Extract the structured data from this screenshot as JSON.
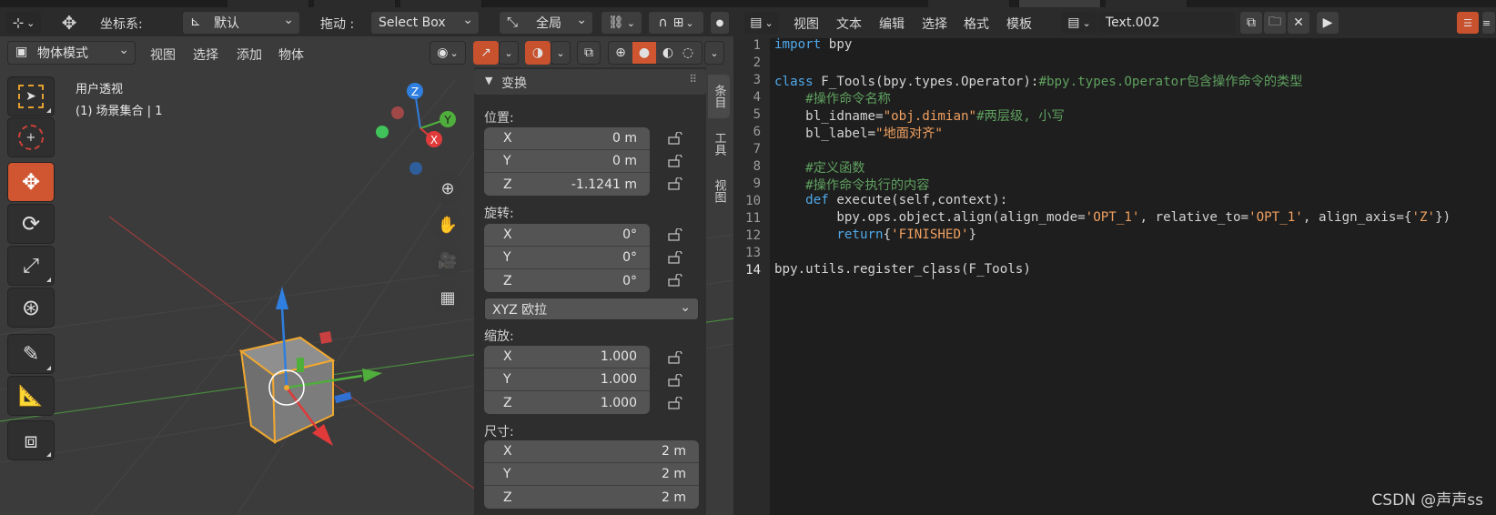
{
  "viewport": {
    "header": {
      "coord_label": "坐标系:",
      "coord_value": "默认",
      "drag_label": "拖动 :",
      "drag_value": "Select Box",
      "pivot_value": "全局"
    },
    "header2": {
      "mode_value": "物体模式",
      "menu": [
        "视图",
        "选择",
        "添加",
        "物体"
      ]
    },
    "overlay_title": "用户透视",
    "overlay_collection": "(1) 场景集合 | 1",
    "gizmo_axes": [
      "Z",
      "Y",
      "X"
    ],
    "tools": [
      "select-box",
      "cursor",
      "move",
      "rotate",
      "scale",
      "transform",
      "annotate",
      "measure",
      "add-cube"
    ],
    "active_tool": "move"
  },
  "npanel": {
    "header": "变换",
    "location_label": "位置:",
    "location": [
      {
        "axis": "X",
        "value": "0 m"
      },
      {
        "axis": "Y",
        "value": "0 m"
      },
      {
        "axis": "Z",
        "value": "-1.1241 m"
      }
    ],
    "rotation_label": "旋转:",
    "rotation": [
      {
        "axis": "X",
        "value": "0°"
      },
      {
        "axis": "Y",
        "value": "0°"
      },
      {
        "axis": "Z",
        "value": "0°"
      }
    ],
    "rotation_mode": "XYZ 欧拉",
    "scale_label": "缩放:",
    "scale": [
      {
        "axis": "X",
        "value": "1.000"
      },
      {
        "axis": "Y",
        "value": "1.000"
      },
      {
        "axis": "Z",
        "value": "1.000"
      }
    ],
    "dimensions_label": "尺寸:",
    "dimensions": [
      {
        "axis": "X",
        "value": "2 m"
      },
      {
        "axis": "Y",
        "value": "2 m"
      },
      {
        "axis": "Z",
        "value": "2 m"
      }
    ],
    "tabs": [
      "条目",
      "工具",
      "视图"
    ]
  },
  "editor": {
    "menu": [
      "视图",
      "文本",
      "编辑",
      "选择",
      "格式",
      "模板"
    ],
    "text_name": "Text.002",
    "line_numbers": [
      "1",
      "2",
      "3",
      "4",
      "5",
      "6",
      "7",
      "8",
      "9",
      "10",
      "11",
      "12",
      "13",
      "14"
    ],
    "current_line": "14",
    "code": {
      "l1_kw": "import",
      "l1_rest": " bpy",
      "l3_kw": "class",
      "l3_rest": " F_Tools(bpy.types.Operator):",
      "l3_cm": "#bpy.types.Operator包含操作命令的类型",
      "l4_cm": "    #操作命令名称",
      "l5_a": "    bl_idname=",
      "l5_s": "\"obj.dimian\"",
      "l5_cm": "#两层级, 小写",
      "l6_a": "    bl_label=",
      "l6_s": "\"地面对齐\"",
      "l8_cm": "    #定义函数",
      "l9_cm": "    #操作命令执行的内容",
      "l10_kw": "    def",
      "l10_rest": " execute(self,context):",
      "l11_a": "        bpy.ops.object.align(align_mode=",
      "l11_s1": "'OPT_1'",
      "l11_b": ", relative_to=",
      "l11_s2": "'OPT_1'",
      "l11_c": ", align_axis={",
      "l11_s3": "'Z'",
      "l11_d": "})",
      "l12_kw": "        return",
      "l12_a": "{",
      "l12_s": "'FINISHED'",
      "l12_b": "}",
      "l14": "bpy.utils.register_class(F_Tools)"
    }
  },
  "watermark": "CSDN @声声ss",
  "colors": {
    "accent_orange": "#cf5631",
    "axis_x": "#e03a3a",
    "axis_y": "#4fae3c",
    "axis_z": "#2f7fe0",
    "keyword": "#4fa8e8",
    "string": "#f0a060",
    "comment": "#5fa05f"
  }
}
